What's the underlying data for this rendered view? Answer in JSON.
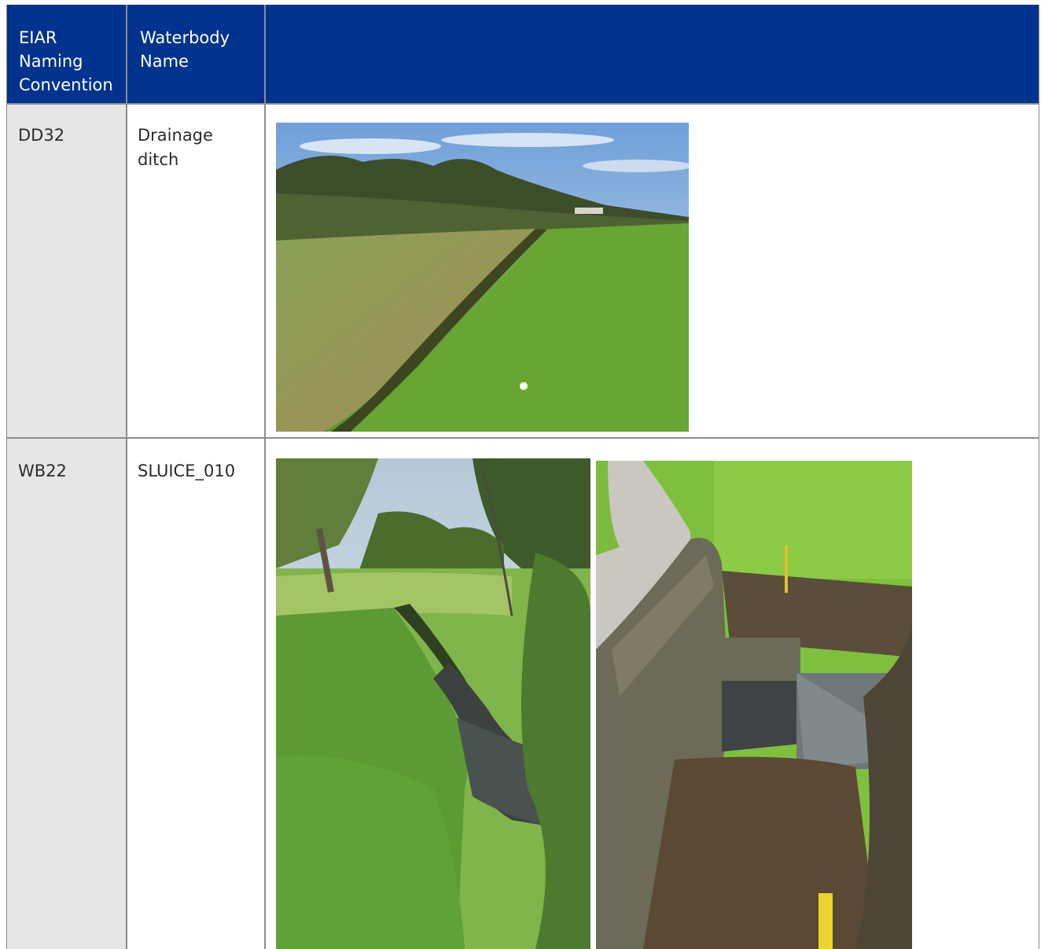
{
  "table": {
    "headers": [
      "EIAR Naming Convention",
      "Waterbody Name",
      ""
    ],
    "header_lines": {
      "col1": [
        "EIAR",
        "Naming",
        "Convention"
      ],
      "col2": [
        "Waterbody",
        "Name"
      ]
    },
    "rows": [
      {
        "code": "DD32",
        "name_lines": [
          "Drainage",
          "ditch"
        ],
        "photos": [
          {
            "alt": "drainage-ditch-photo"
          }
        ]
      },
      {
        "code": "WB22",
        "name_lines": [
          "SLUICE_010"
        ],
        "photos": [
          {
            "alt": "stream-channel-photo"
          },
          {
            "alt": "sluice-wall-photo"
          }
        ]
      }
    ]
  },
  "colors": {
    "header_bg": "#00338d",
    "header_text": "#ffffff",
    "first_column_bg": "#e7e6e6",
    "grid_line": "#8c8c8c"
  }
}
